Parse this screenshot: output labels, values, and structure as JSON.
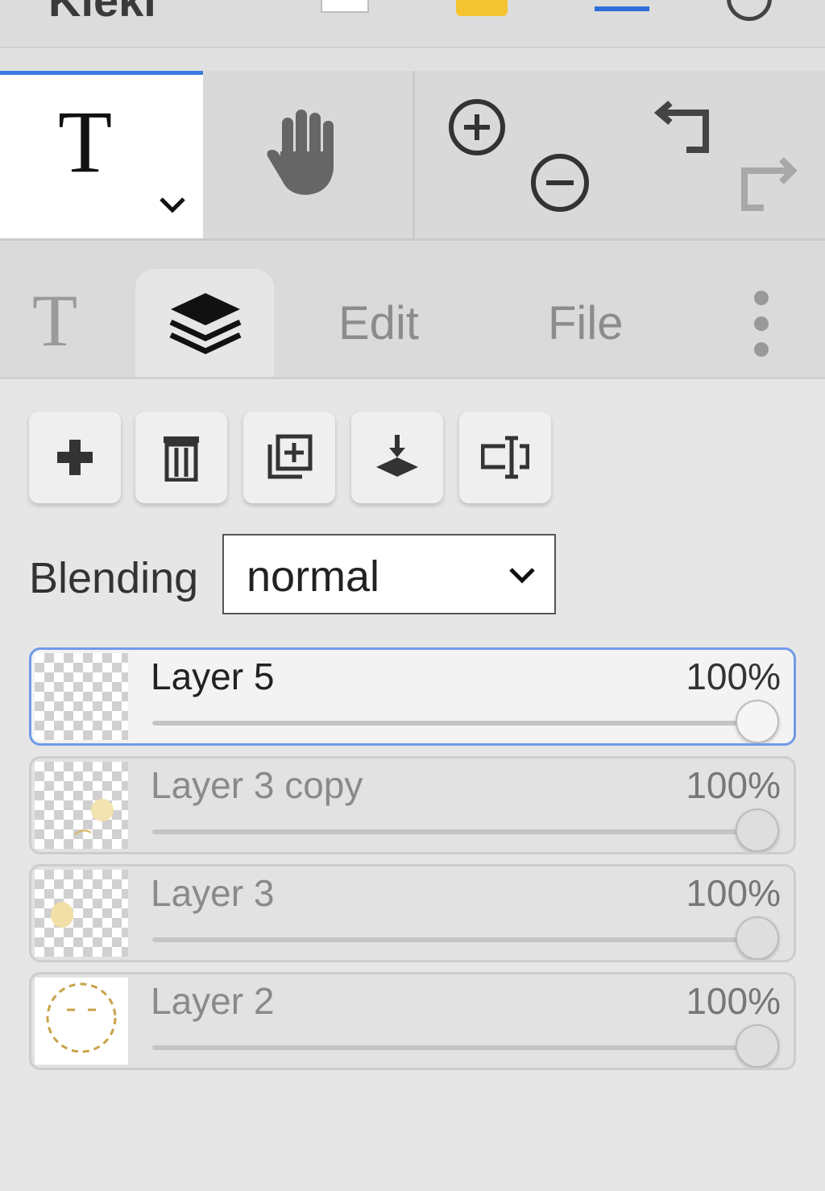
{
  "app": {
    "logo_text": "Kleki"
  },
  "toolbar": {
    "text_tool_glyph": "T",
    "icons": [
      "chevron-down-icon",
      "hand-icon",
      "zoom-in-icon",
      "zoom-out-icon",
      "undo-icon",
      "redo-icon"
    ]
  },
  "tabs": {
    "text_glyph": "T",
    "layers_icon": "layers-icon",
    "edit_label": "Edit",
    "file_label": "File",
    "more_icon": "more-vertical-icon"
  },
  "layer_actions": {
    "icons": [
      "plus-icon",
      "trash-icon",
      "duplicate-icon",
      "merge-down-icon",
      "rename-icon"
    ]
  },
  "blending": {
    "label": "Blending",
    "value": "normal"
  },
  "layers": [
    {
      "name": "Layer 5",
      "opacity": "100%",
      "opacity_value": 1.0,
      "active": true
    },
    {
      "name": "Layer 3 copy",
      "opacity": "100%",
      "opacity_value": 1.0,
      "active": false
    },
    {
      "name": "Layer 3",
      "opacity": "100%",
      "opacity_value": 1.0,
      "active": false
    },
    {
      "name": "Layer 2",
      "opacity": "100%",
      "opacity_value": 1.0,
      "active": false
    }
  ],
  "colors": {
    "accent": "#3b7be0",
    "panel_bg": "#e6e6e6",
    "primary_swatch": "#f4c430"
  }
}
